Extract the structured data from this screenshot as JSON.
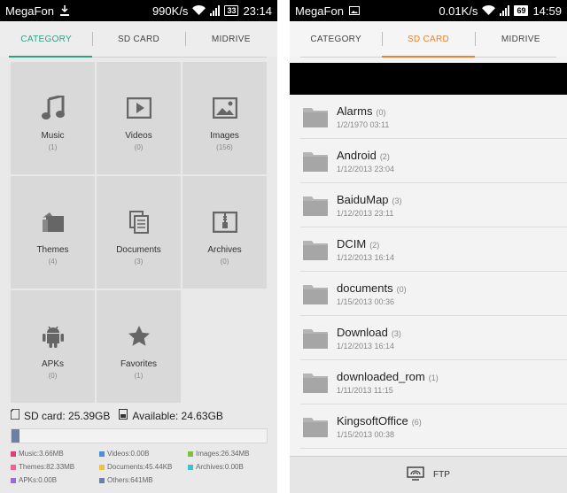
{
  "left": {
    "status": {
      "carrier": "MegaFon",
      "speed": "990K/s",
      "battery": "33",
      "time": "23:14"
    },
    "tabs": [
      {
        "label": "CATEGORY"
      },
      {
        "label": "SD CARD"
      },
      {
        "label": "MIDRIVE"
      }
    ],
    "categories": [
      {
        "label": "Music",
        "count": "(1)"
      },
      {
        "label": "Videos",
        "count": "(0)"
      },
      {
        "label": "Images",
        "count": "(156)"
      },
      {
        "label": "Themes",
        "count": "(4)"
      },
      {
        "label": "Documents",
        "count": "(3)"
      },
      {
        "label": "Archives",
        "count": "(0)"
      },
      {
        "label": "APKs",
        "count": "(0)"
      },
      {
        "label": "Favorites",
        "count": "(1)"
      }
    ],
    "storage": {
      "sd": "SD card: 25.39GB",
      "available": "Available: 24.63GB",
      "used_fraction": 0.03
    },
    "legend": [
      {
        "label": "Music:3.66MB",
        "color": "#e0407a"
      },
      {
        "label": "Videos:0.00B",
        "color": "#4a90d9"
      },
      {
        "label": "Images:26.34MB",
        "color": "#7bc043"
      },
      {
        "label": "Themes:82.33MB",
        "color": "#f06292"
      },
      {
        "label": "Documents:45.44KB",
        "color": "#f0c040"
      },
      {
        "label": "Archives:0.00B",
        "color": "#40c0d0"
      },
      {
        "label": "APKs:0.00B",
        "color": "#9c6ad6"
      },
      {
        "label": "Others:641MB",
        "color": "#6b7fa8"
      }
    ],
    "accent": "#2f9f86"
  },
  "right": {
    "status": {
      "carrier": "MegaFon",
      "speed": "0.01K/s",
      "battery": "69",
      "time": "14:59"
    },
    "tabs": [
      {
        "label": "CATEGORY"
      },
      {
        "label": "SD CARD"
      },
      {
        "label": "MIDRIVE"
      }
    ],
    "folders": [
      {
        "name": "Alarms",
        "count": "(0)",
        "date": "1/2/1970 03:11"
      },
      {
        "name": "Android",
        "count": "(2)",
        "date": "1/12/2013 23:04"
      },
      {
        "name": "BaiduMap",
        "count": "(3)",
        "date": "1/12/2013 23:11"
      },
      {
        "name": "DCIM",
        "count": "(2)",
        "date": "1/12/2013 16:14"
      },
      {
        "name": "documents",
        "count": "(0)",
        "date": "1/15/2013 00:36"
      },
      {
        "name": "Download",
        "count": "(3)",
        "date": "1/12/2013 16:14"
      },
      {
        "name": "downloaded_rom",
        "count": "(1)",
        "date": "1/11/2013 11:15"
      },
      {
        "name": "KingsoftOffice",
        "count": "(6)",
        "date": "1/15/2013 00:38"
      }
    ],
    "ftp_label": "FTP",
    "accent": "#f08030"
  }
}
